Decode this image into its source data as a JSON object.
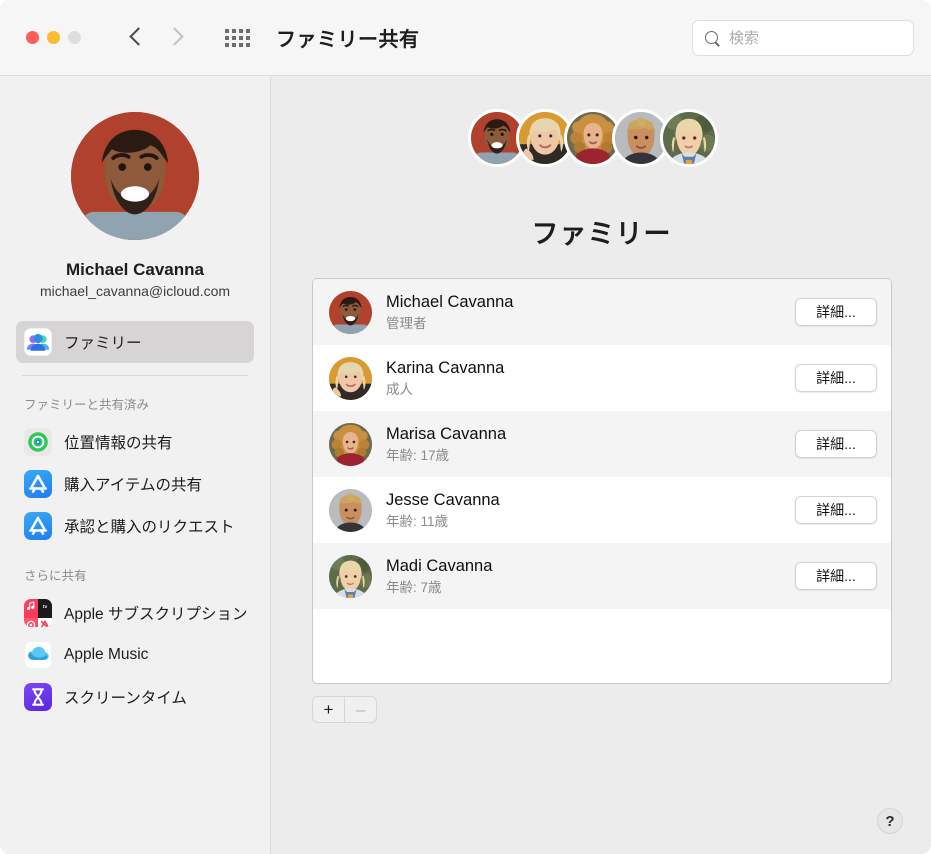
{
  "window": {
    "title": "ファミリー共有",
    "traffic_lights": [
      "close",
      "minimize",
      "zoom"
    ],
    "nav": {
      "back": "back-chevron",
      "forward": "forward-chevron",
      "grid": "show-all-grid"
    }
  },
  "search": {
    "placeholder": "検索",
    "value": "",
    "icon": "search-icon"
  },
  "sidebar": {
    "account": {
      "name": "Michael Cavanna",
      "email": "michael_cavanna@icloud.com",
      "avatar": "michael-avatar"
    },
    "primary": [
      {
        "label": "ファミリー",
        "icon": "family-icon",
        "selected": true
      }
    ],
    "sections": [
      {
        "title": "ファミリーと共有済み",
        "items": [
          {
            "label": "位置情報の共有",
            "icon": "find-my-icon"
          },
          {
            "label": "購入アイテムの共有",
            "icon": "app-store-icon"
          },
          {
            "label": "承認と購入のリクエスト",
            "icon": "app-store-icon"
          }
        ]
      },
      {
        "title": "さらに共有",
        "items": [
          {
            "label": "Apple サブスクリプション",
            "icon": "apple-subscriptions-icon"
          },
          {
            "label": "Apple Music",
            "icon": "apple-music-cloud-icon"
          },
          {
            "label": "スクリーンタイム",
            "icon": "screen-time-icon"
          }
        ]
      }
    ]
  },
  "main": {
    "heading": "ファミリー",
    "avatar_stack": [
      "michael-avatar",
      "karina-avatar",
      "marisa-avatar",
      "jesse-avatar",
      "madi-avatar"
    ],
    "members": [
      {
        "name": "Michael Cavanna",
        "role": "管理者",
        "details_label": "詳細...",
        "avatar": "michael-avatar"
      },
      {
        "name": "Karina Cavanna",
        "role": "成人",
        "details_label": "詳細...",
        "avatar": "karina-avatar"
      },
      {
        "name": "Marisa Cavanna",
        "role": "年齢: 17歳",
        "details_label": "詳細...",
        "avatar": "marisa-avatar"
      },
      {
        "name": "Jesse Cavanna",
        "role": "年齢: 11歳",
        "details_label": "詳細...",
        "avatar": "jesse-avatar"
      },
      {
        "name": "Madi Cavanna",
        "role": "年齢: 7歳",
        "details_label": "詳細...",
        "avatar": "madi-avatar"
      }
    ],
    "add_button": "+",
    "remove_button": "–",
    "help_button": "?"
  },
  "colors": {
    "window_bg": "#ececec",
    "sidebar_bg": "#f1f1f1",
    "titlebar_bg": "#f6f6f6",
    "list_bg": "#ffffff",
    "stripe_bg": "#f4f4f4",
    "selection": "#d6d4d4",
    "secondary_text": "#8a8a8a",
    "traffic_close": "#fb5f57",
    "traffic_min": "#fcbc2d",
    "traffic_zoom": "#dedede"
  }
}
